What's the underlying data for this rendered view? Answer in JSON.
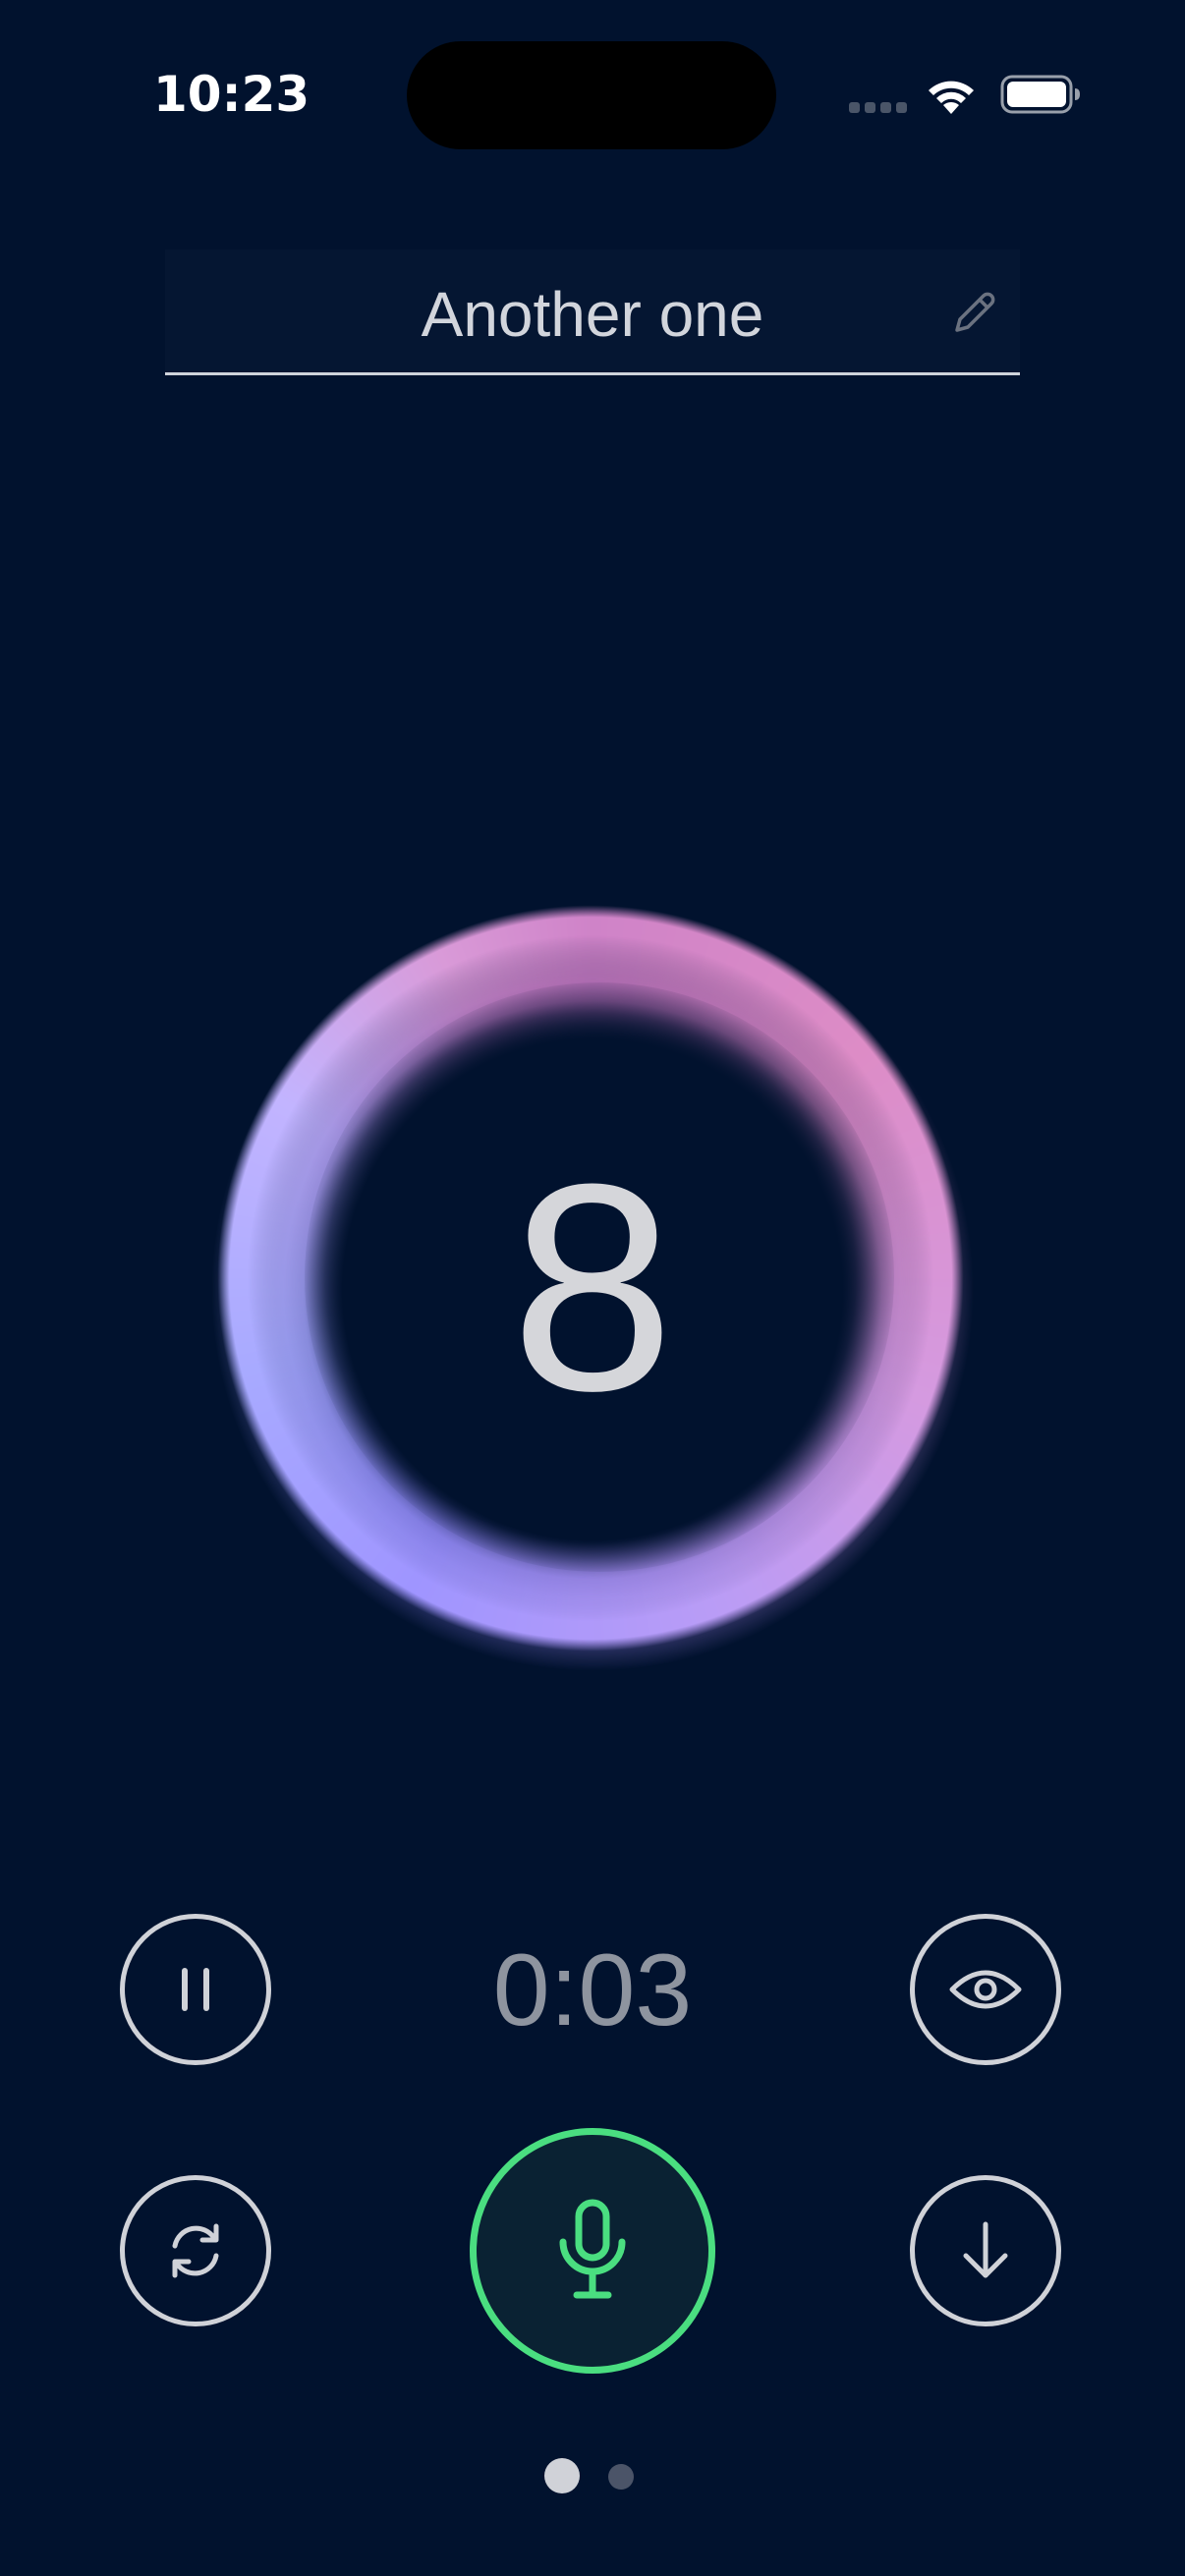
{
  "status_bar": {
    "time": "10:23"
  },
  "header": {
    "title": "Another one"
  },
  "counter": {
    "value": "8"
  },
  "controls": {
    "timer": "0:03"
  },
  "pager": {
    "total_pages": 2,
    "active_page": 1
  },
  "icons": {
    "pause": "pause-icon",
    "view": "eye-icon",
    "refresh": "refresh-icon",
    "record": "microphone-icon",
    "download": "arrow-down-icon",
    "edit": "pencil-icon"
  },
  "colors": {
    "background": "#01122e",
    "accent_green": "#4ade80",
    "ring_pink": "#d07fc0",
    "ring_violet": "#9f95ff",
    "control_outline": "#d0d2d8",
    "timer_text": "#8e949f"
  }
}
